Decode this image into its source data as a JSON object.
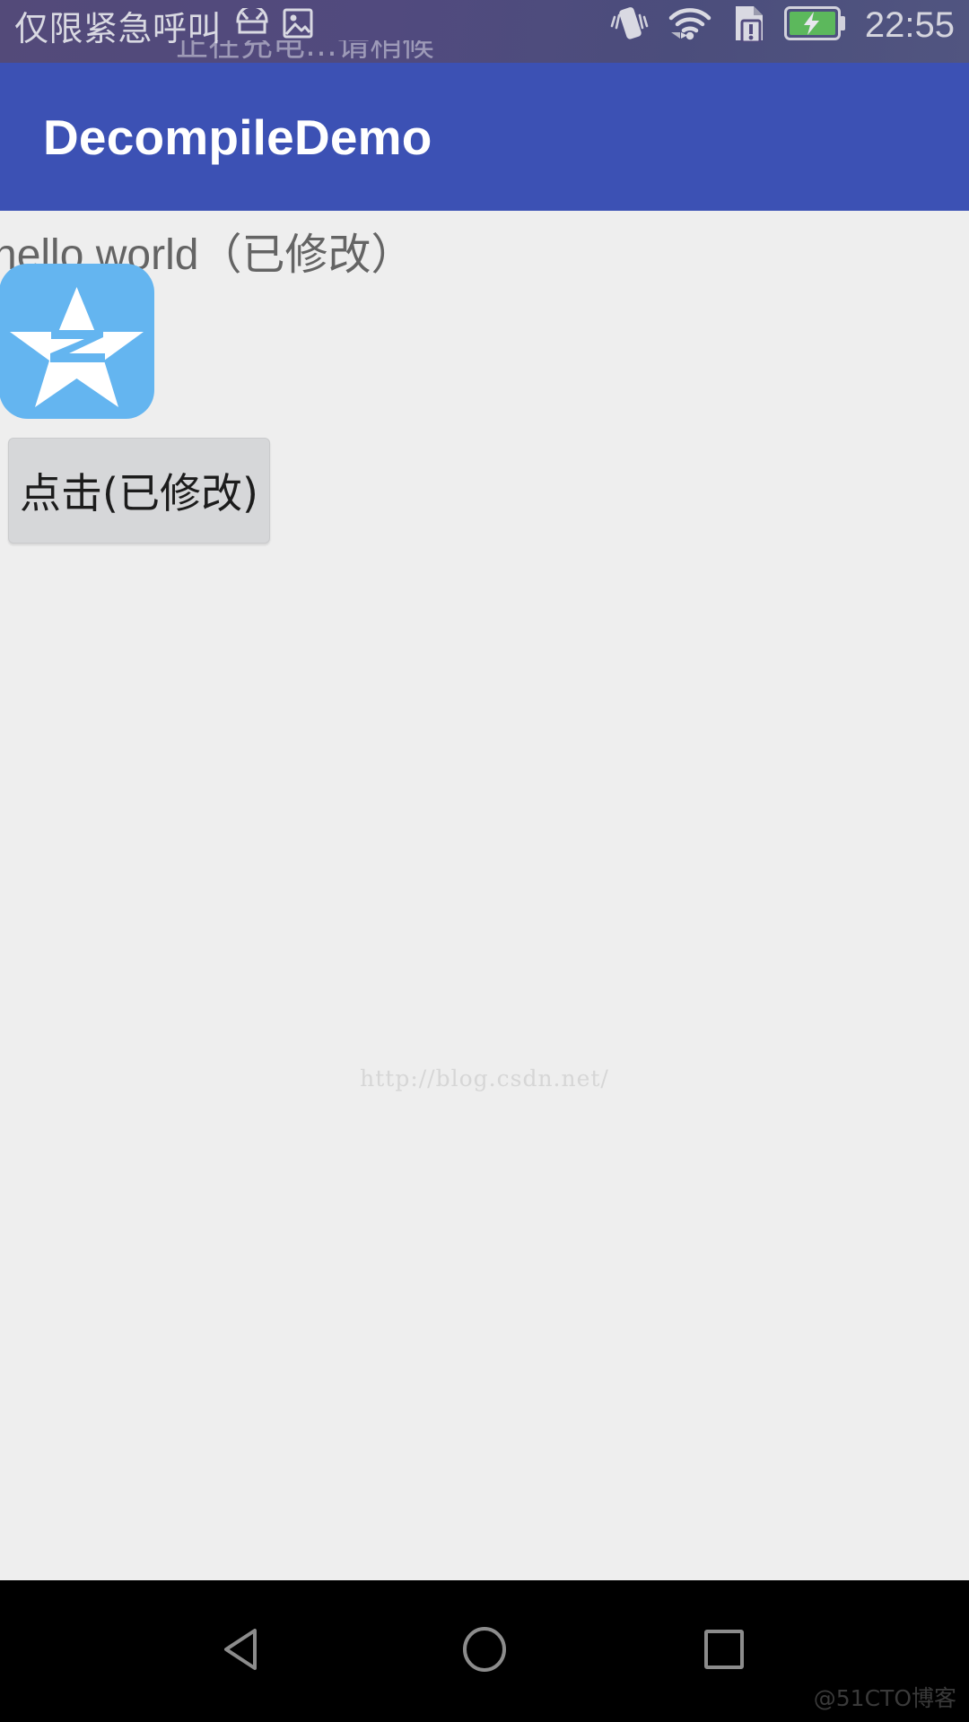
{
  "status_bar": {
    "carrier_text": "仅限紧急呼叫",
    "clock": "22:55",
    "left_icons": [
      "android-robot-icon",
      "image-placeholder-icon"
    ],
    "right_icons": [
      "vibrate-icon",
      "wifi-icon",
      "sim-card-alert-icon",
      "battery-charging-icon"
    ],
    "notification_ghost_text": "正在充电…请稍候",
    "background_color": "#514A7E",
    "battery_color": "#5cb85c"
  },
  "app_bar": {
    "title": "DecompileDemo",
    "background_color": "#3F51B5",
    "title_color": "#FFFFFF"
  },
  "content": {
    "hello_text": "hello world（已修改）",
    "hello_text_color": "#646464",
    "app_icon_name": "star-z-app-icon",
    "app_icon_background": "#64B5F0",
    "button_label": "点击(已修改)",
    "button_background": "#D6D7D9",
    "background_color": "#EEEEEE",
    "watermark": "http://blog.csdn.net/"
  },
  "nav_bar": {
    "background_color": "#000000",
    "buttons": [
      {
        "name": "back-button",
        "icon": "triangle-left-icon"
      },
      {
        "name": "home-button",
        "icon": "circle-icon"
      },
      {
        "name": "recents-button",
        "icon": "square-icon"
      }
    ],
    "watermark": "@51CTO博客"
  }
}
